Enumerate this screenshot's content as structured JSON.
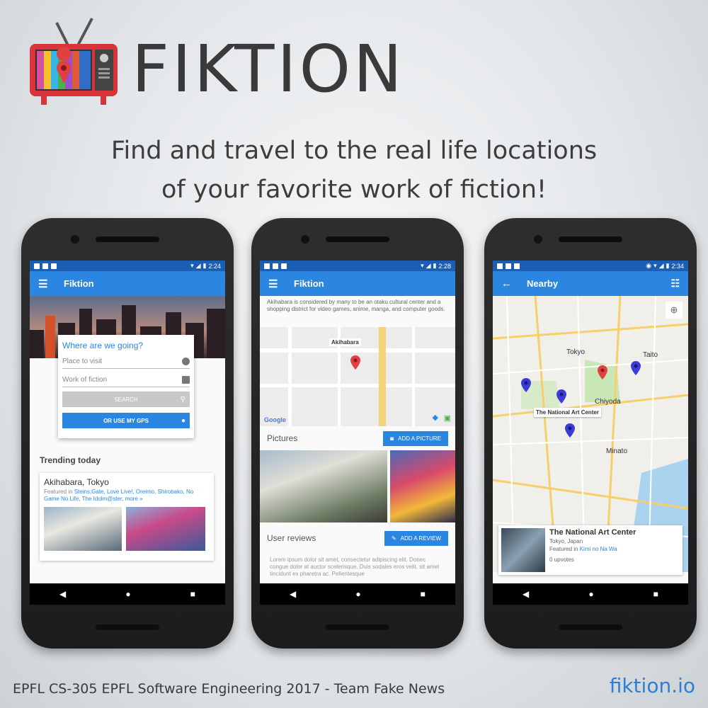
{
  "brand": {
    "name": "FIKTION"
  },
  "tagline": {
    "line1": "Find and travel to the real life locations",
    "line2": "of your favorite work of fiction!"
  },
  "footer": {
    "left": "EPFL CS-305 EPFL Software Engineering  2017 - Team Fake News",
    "right": "fiktion.io"
  },
  "colors": {
    "primary": "#2a86e0",
    "statusbar": "#1a5fb4",
    "pin_blue": "#3b3bd9",
    "pin_red": "#e04040"
  },
  "phone1": {
    "time": "2:24",
    "appbar_title": "Fiktion",
    "search_title": "Where are we going?",
    "place_placeholder": "Place to visit",
    "work_placeholder": "Work of fiction",
    "search_button": "SEARCH",
    "gps_button": "OR USE MY GPS",
    "trending_title": "Trending today",
    "card_title": "Akihabara, Tokyo",
    "featured_prefix": "Featured in ",
    "featured_works": "Steins;Gate, Love Live!, Oreimo, Shirobako, No Game No Life, The Idolm@ster, more »"
  },
  "phone2": {
    "time": "2:28",
    "appbar_title": "Fiktion",
    "description": "Akihabara is considered by many to be an otaku cultural center and a shopping district for video games, anime, manga, and computer goods.",
    "map_label": "Akihabara",
    "map_google": "Google",
    "pictures_label": "Pictures",
    "add_picture": "ADD A PICTURE",
    "reviews_label": "User reviews",
    "add_review": "ADD A REVIEW",
    "review_text": "Lorem ipsum dolor sit amet, consectetur adipiscing elit. Donec congue dolor at auctor scelerisque. Duis sodales eros velit, sit amet tincidunt ex pharetra ac. Pellentesque"
  },
  "phone3": {
    "time": "2:34",
    "appbar_title": "Nearby",
    "map_labels": {
      "tokyo": "Tokyo",
      "chiyoda": "Chiyoda",
      "minato": "Minato",
      "taito": "Taito"
    },
    "pin_label": "The National Art Center",
    "place_title": "The National Art Center",
    "place_location": "Tokyo, Japan",
    "place_featured_prefix": "Featured in ",
    "place_featured_work": "Kimi no Na Wa",
    "place_upvotes": "0 upvotes"
  }
}
